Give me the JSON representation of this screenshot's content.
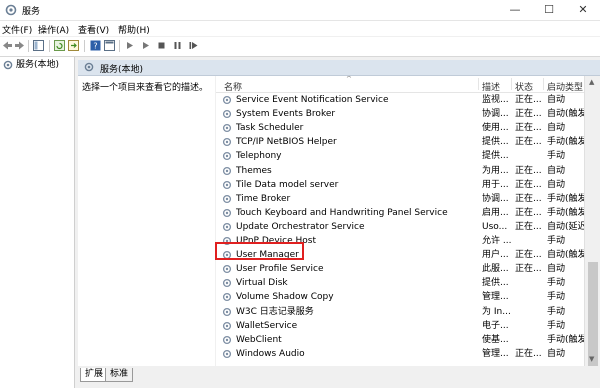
{
  "window": {
    "title": "服务",
    "minimize": "—",
    "maximize": "☐",
    "close": "✕"
  },
  "menu": {
    "items": [
      "文件(F)",
      "操作(A)",
      "查看(V)",
      "帮助(H)"
    ]
  },
  "toolbar": {
    "icons": [
      "back-icon",
      "forward-icon",
      "show-tree-icon",
      "refresh-icon",
      "export-icon",
      "help-icon",
      "properties-icon",
      "start-icon",
      "start-alt-icon",
      "stop-icon",
      "pause-icon",
      "restart-icon"
    ]
  },
  "tree": {
    "item_label": "服务(本地)"
  },
  "panel": {
    "header": "服务(本地)",
    "description_hint": "选择一个项目来查看它的描述。"
  },
  "table": {
    "headers": {
      "name": "名称",
      "desc": "描述",
      "status": "状态",
      "startup": "启动类型"
    },
    "sort_arrow": "^",
    "rows": [
      {
        "name": "Service Event Notification Service",
        "desc": "监视...",
        "status": "正在...",
        "startup": "自动"
      },
      {
        "name": "System Events Broker",
        "desc": "协调...",
        "status": "正在...",
        "startup": "自动(触发..."
      },
      {
        "name": "Task Scheduler",
        "desc": "使用...",
        "status": "正在...",
        "startup": "自动"
      },
      {
        "name": "TCP/IP NetBIOS Helper",
        "desc": "提供...",
        "status": "正在...",
        "startup": "手动(触发..."
      },
      {
        "name": "Telephony",
        "desc": "提供...",
        "status": "",
        "startup": "手动"
      },
      {
        "name": "Themes",
        "desc": "为用...",
        "status": "正在...",
        "startup": "自动"
      },
      {
        "name": "Tile Data model server",
        "desc": "用于...",
        "status": "正在...",
        "startup": "自动"
      },
      {
        "name": "Time Broker",
        "desc": "协调...",
        "status": "正在...",
        "startup": "手动(触发..."
      },
      {
        "name": "Touch Keyboard and Handwriting Panel Service",
        "desc": "启用...",
        "status": "正在...",
        "startup": "手动(触发..."
      },
      {
        "name": "Update Orchestrator Service",
        "desc": "Uso...",
        "status": "正在...",
        "startup": "自动(延迟..."
      },
      {
        "name": "UPnP Device Host",
        "desc": "允许 ...",
        "status": "",
        "startup": "手动"
      },
      {
        "name": "User Manager",
        "desc": "用户...",
        "status": "正在...",
        "startup": "自动(触发..."
      },
      {
        "name": "User Profile Service",
        "desc": "此服...",
        "status": "正在...",
        "startup": "自动"
      },
      {
        "name": "Virtual Disk",
        "desc": "提供...",
        "status": "",
        "startup": "手动"
      },
      {
        "name": "Volume Shadow Copy",
        "desc": "管理...",
        "status": "",
        "startup": "手动"
      },
      {
        "name": "W3C 日志记录服务",
        "desc": "为 In...",
        "status": "",
        "startup": "手动"
      },
      {
        "name": "WalletService",
        "desc": "电子...",
        "status": "",
        "startup": "手动"
      },
      {
        "name": "WebClient",
        "desc": "使基...",
        "status": "",
        "startup": "手动(触发..."
      },
      {
        "name": "Windows Audio",
        "desc": "管理...",
        "status": "正在...",
        "startup": "自动"
      }
    ]
  },
  "tabs": [
    "扩展",
    "标准"
  ],
  "colors": {
    "highlight_border": "#e02020",
    "panel_header_bg": "#dbe4ee"
  }
}
